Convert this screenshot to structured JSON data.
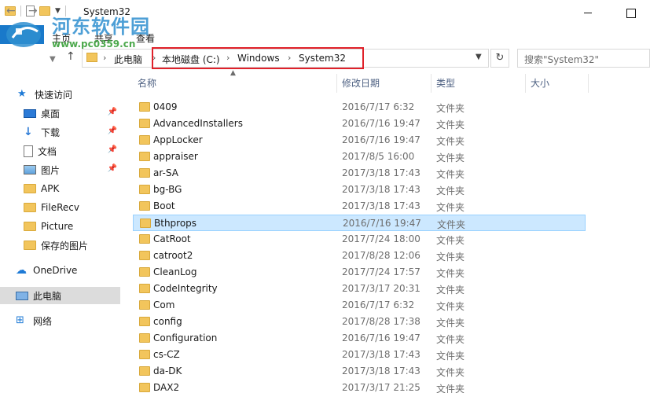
{
  "window": {
    "title": "System32"
  },
  "ribbon": {
    "tabs": [
      "主页",
      "共享",
      "查看"
    ]
  },
  "watermark": {
    "line1": "河东软件园",
    "line2": "www.pc0359.cn"
  },
  "address": {
    "crumbs": [
      "此电脑",
      "本地磁盘 (C:)",
      "Windows",
      "System32"
    ],
    "search_placeholder": "搜索\"System32\""
  },
  "nav": {
    "quick_access": "快速访问",
    "items": [
      {
        "label": "桌面",
        "icon": "desktop-icon",
        "pinned": true
      },
      {
        "label": "下载",
        "icon": "download-icon",
        "pinned": true
      },
      {
        "label": "文档",
        "icon": "document-icon",
        "pinned": true
      },
      {
        "label": "图片",
        "icon": "picture-icon",
        "pinned": true
      },
      {
        "label": "APK",
        "icon": "folder-icon",
        "pinned": false
      },
      {
        "label": "FileRecv",
        "icon": "folder-icon",
        "pinned": false
      },
      {
        "label": "Picture",
        "icon": "folder-icon",
        "pinned": false
      },
      {
        "label": "保存的图片",
        "icon": "folder-icon",
        "pinned": false
      }
    ],
    "onedrive": "OneDrive",
    "this_pc": "此电脑",
    "network": "网络"
  },
  "columns": {
    "name": "名称",
    "date": "修改日期",
    "type": "类型",
    "size": "大小"
  },
  "files": [
    {
      "name": "0409",
      "date": "2016/7/17 6:32",
      "type": "文件夹"
    },
    {
      "name": "AdvancedInstallers",
      "date": "2016/7/16 19:47",
      "type": "文件夹"
    },
    {
      "name": "AppLocker",
      "date": "2016/7/16 19:47",
      "type": "文件夹"
    },
    {
      "name": "appraiser",
      "date": "2017/8/5 16:00",
      "type": "文件夹"
    },
    {
      "name": "ar-SA",
      "date": "2017/3/18 17:43",
      "type": "文件夹"
    },
    {
      "name": "bg-BG",
      "date": "2017/3/18 17:43",
      "type": "文件夹"
    },
    {
      "name": "Boot",
      "date": "2017/3/18 17:43",
      "type": "文件夹"
    },
    {
      "name": "Bthprops",
      "date": "2016/7/16 19:47",
      "type": "文件夹",
      "selected": true
    },
    {
      "name": "CatRoot",
      "date": "2017/7/24 18:00",
      "type": "文件夹"
    },
    {
      "name": "catroot2",
      "date": "2017/8/28 12:06",
      "type": "文件夹"
    },
    {
      "name": "CleanLog",
      "date": "2017/7/24 17:57",
      "type": "文件夹"
    },
    {
      "name": "CodeIntegrity",
      "date": "2017/3/17 20:31",
      "type": "文件夹"
    },
    {
      "name": "Com",
      "date": "2016/7/17 6:32",
      "type": "文件夹"
    },
    {
      "name": "config",
      "date": "2017/8/28 17:38",
      "type": "文件夹"
    },
    {
      "name": "Configuration",
      "date": "2016/7/16 19:47",
      "type": "文件夹"
    },
    {
      "name": "cs-CZ",
      "date": "2017/3/18 17:43",
      "type": "文件夹"
    },
    {
      "name": "da-DK",
      "date": "2017/3/18 17:43",
      "type": "文件夹"
    },
    {
      "name": "DAX2",
      "date": "2017/3/17 21:25",
      "type": "文件夹"
    }
  ]
}
